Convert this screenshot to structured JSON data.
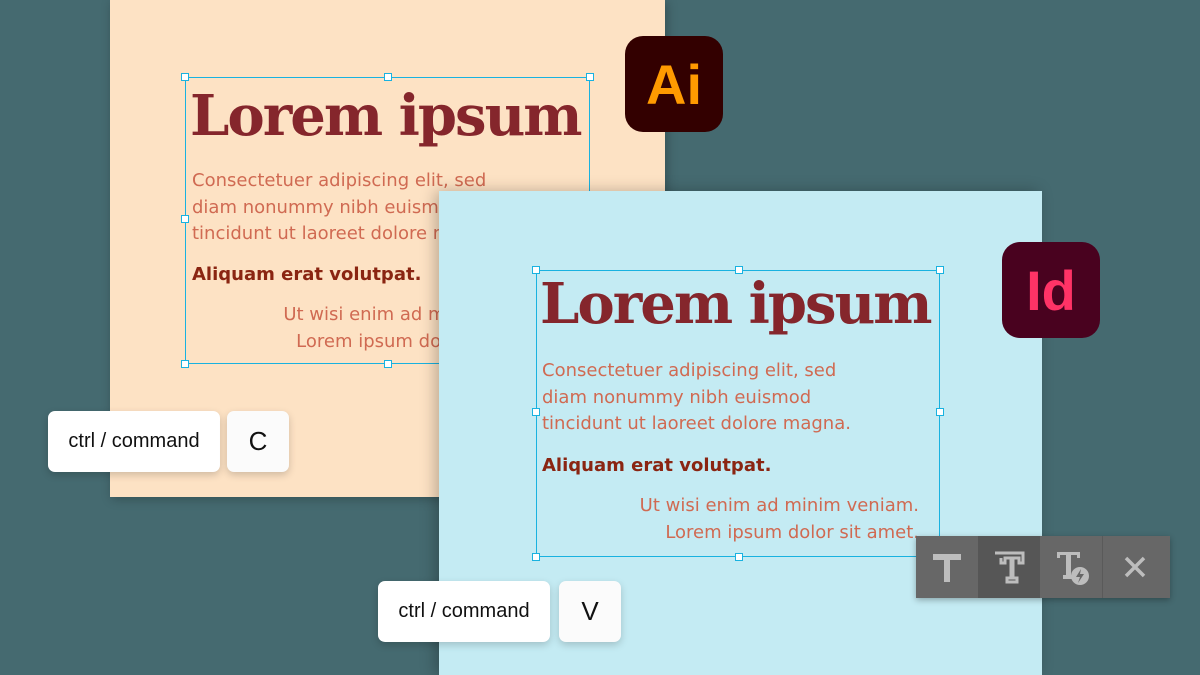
{
  "colors": {
    "background": "#456a70",
    "illustrator_panel": "#fde2c4",
    "indesign_panel": "#c4ebf3",
    "selection": "#19b2e0",
    "title": "#85262c",
    "body": "#d06a52",
    "bold": "#8a2512",
    "ai_badge_bg": "#330000",
    "ai_badge_fg": "#ff9a00",
    "id_badge_bg": "#49021f",
    "id_badge_fg": "#ff3366",
    "toolbar": "#676767"
  },
  "illustrator": {
    "app_icon": "illustrator-icon",
    "app_label": "Ai",
    "title": "Lorem ipsum",
    "body_lines": [
      "Consectetuer adipiscing elit, sed",
      "diam nonummy nibh euismod",
      "tincidunt ut laoreet dolore magna."
    ],
    "bold_line": "Aliquam erat volutpat.",
    "right_lines": [
      "Ut wisi enim ad minim veniam.",
      "Lorem ipsum dolor sit amet."
    ],
    "shortcut": {
      "modifier": "ctrl / command",
      "key": "C"
    }
  },
  "indesign": {
    "app_icon": "indesign-icon",
    "app_label": "Id",
    "title": "Lorem ipsum",
    "body_lines": [
      "Consectetuer adipiscing elit, sed",
      "diam nonummy nibh euismod",
      "tincidunt ut laoreet dolore magna."
    ],
    "bold_line": "Aliquam erat volutpat.",
    "right_lines": [
      "Ut wisi enim ad minim veniam.",
      "Lorem ipsum dolor sit amet."
    ],
    "shortcut": {
      "modifier": "ctrl / command",
      "key": "V"
    }
  },
  "paste_toolbar": {
    "buttons": [
      {
        "icon": "plain-text-icon",
        "label": "T",
        "active": false
      },
      {
        "icon": "formatted-text-icon",
        "label": "T",
        "active": true
      },
      {
        "icon": "text-quick-action-icon",
        "label": "T",
        "active": false
      },
      {
        "icon": "close-icon",
        "label": "✕",
        "active": false
      }
    ]
  }
}
